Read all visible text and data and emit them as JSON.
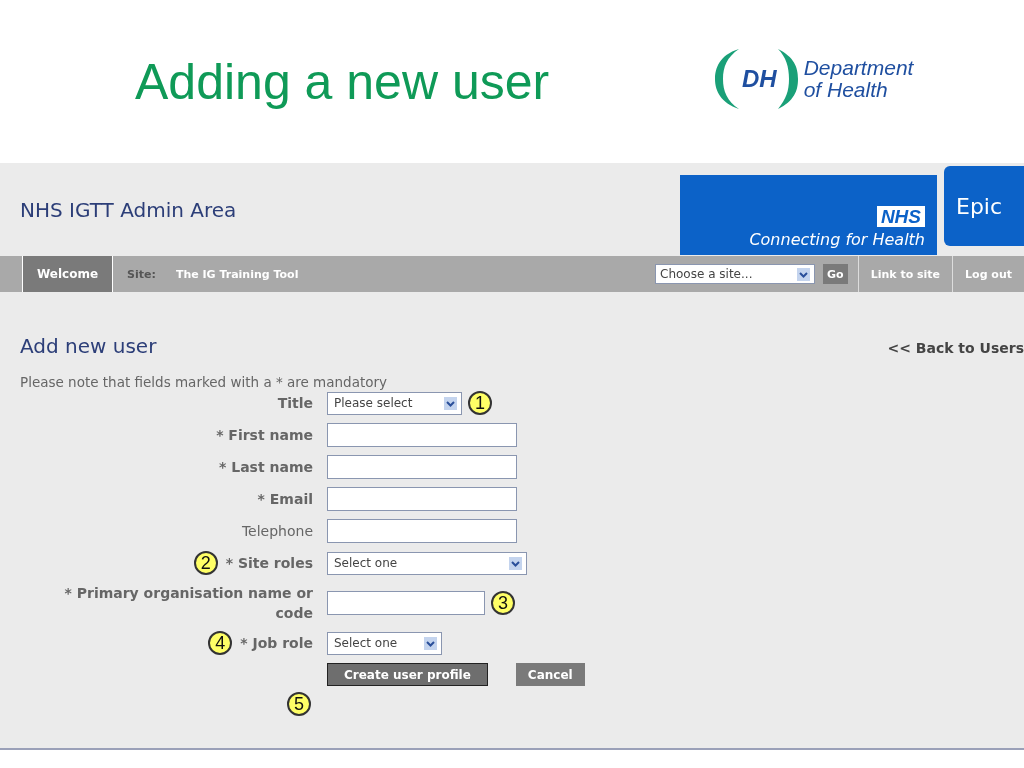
{
  "slide": {
    "title": "Adding a new user",
    "logo": {
      "initials": "DH",
      "line_1": "Department",
      "line_2": "of Health"
    }
  },
  "app": {
    "title": "NHS IGTT Admin Area",
    "banner": {
      "mark": "NHS",
      "tagline": "Connecting for Health"
    },
    "badge": "Epic"
  },
  "nav": {
    "tabs": [
      {
        "label": "Welcome",
        "selected": true
      }
    ],
    "site_label": "Site:",
    "site_name": "The IG Training Tool",
    "site_select": {
      "value": "Choose a site..."
    },
    "go": "Go",
    "links": [
      "Link to site",
      "Log out"
    ]
  },
  "page": {
    "heading": "Add new user",
    "back_link": "<< Back to Users",
    "note": "Please note that fields marked with a * are mandatory"
  },
  "fields": [
    {
      "label": "Title",
      "bold": true,
      "kind": "select",
      "value": "Please select",
      "callout": {
        "label": "1",
        "kind": "after"
      }
    },
    {
      "label": "* First name",
      "bold": true,
      "kind": "text"
    },
    {
      "label": "* Last name",
      "bold": true,
      "kind": "text"
    },
    {
      "label": "* Email",
      "bold": true,
      "kind": "text"
    },
    {
      "label": "Telephone",
      "bold": false,
      "kind": "text"
    },
    {
      "label": "* Site roles",
      "bold": true,
      "kind": "select",
      "value": "Select one",
      "callout": {
        "label": "2",
        "kind": "before"
      }
    },
    {
      "label": "* Primary organisation name or code",
      "bold": true,
      "kind": "text",
      "callout": {
        "label": "3",
        "kind": "after"
      }
    },
    {
      "label": "* Job role",
      "bold": true,
      "kind": "select",
      "value": "Select one",
      "callout": {
        "label": "4",
        "kind": "before"
      }
    }
  ],
  "actions": [
    {
      "label": "Create user profile",
      "kind": "primary",
      "callout": "5"
    },
    {
      "label": "Cancel",
      "kind": "secondary"
    }
  ]
}
